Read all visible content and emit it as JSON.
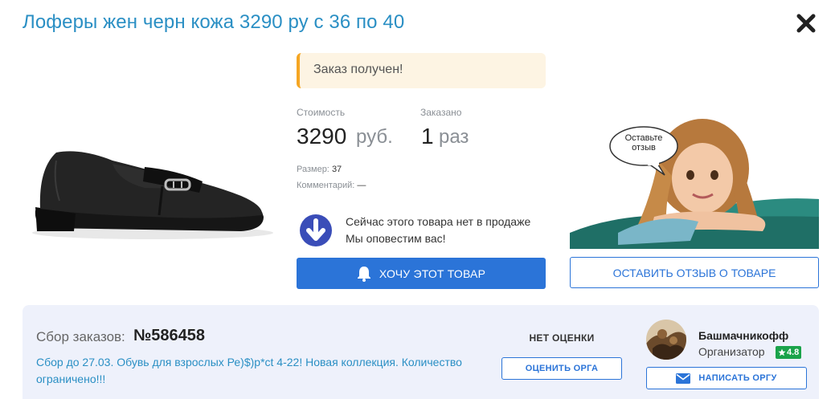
{
  "product": {
    "title": "Лоферы жен черн кожа 3290 ру с 36 по 40"
  },
  "status": {
    "notice": "Заказ получен!"
  },
  "price": {
    "label": "Стоимость",
    "value": "3290",
    "unit": "руб."
  },
  "ordered": {
    "label": "Заказано",
    "value": "1",
    "unit": "раз"
  },
  "details": {
    "size_label": "Размер:",
    "size_value": "37",
    "comment_label": "Комментарий:",
    "comment_value": "—"
  },
  "availability": {
    "line1": "Сейчас этого товара нет в продаже",
    "line2": "Мы оповестим вас!"
  },
  "actions": {
    "want_label": "ХОЧУ ЭТОТ ТОВАР",
    "review_label": "ОСТАВИТЬ ОТЗЫВ О ТОВАРЕ",
    "review_bubble": "Оставьте отзыв"
  },
  "collection": {
    "label": "Сбор заказов:",
    "number": "№586458",
    "description": "Сбор до 27.03. Обувь для взрослых Ре)$)р*ct 4-22! Новая коллекция. Количество ограничено!!!"
  },
  "rating": {
    "no_rating": "НЕТ ОЦЕНКИ",
    "rate_label": "ОЦЕНИТЬ ОРГА"
  },
  "organizer": {
    "name": "Башмачникофф",
    "role": "Организатор",
    "rating": "4.8",
    "write_label": "НАПИСАТЬ ОРГУ"
  },
  "colors": {
    "accent": "#2b74d8",
    "title": "#2a8fc4",
    "notice_border": "#f5a623",
    "rating_badge": "#1aa34a"
  },
  "icons": {
    "close": "close-icon",
    "download": "arrow-down-circle-icon",
    "bell": "bell-icon",
    "mail": "envelope-icon",
    "star": "star-icon"
  }
}
